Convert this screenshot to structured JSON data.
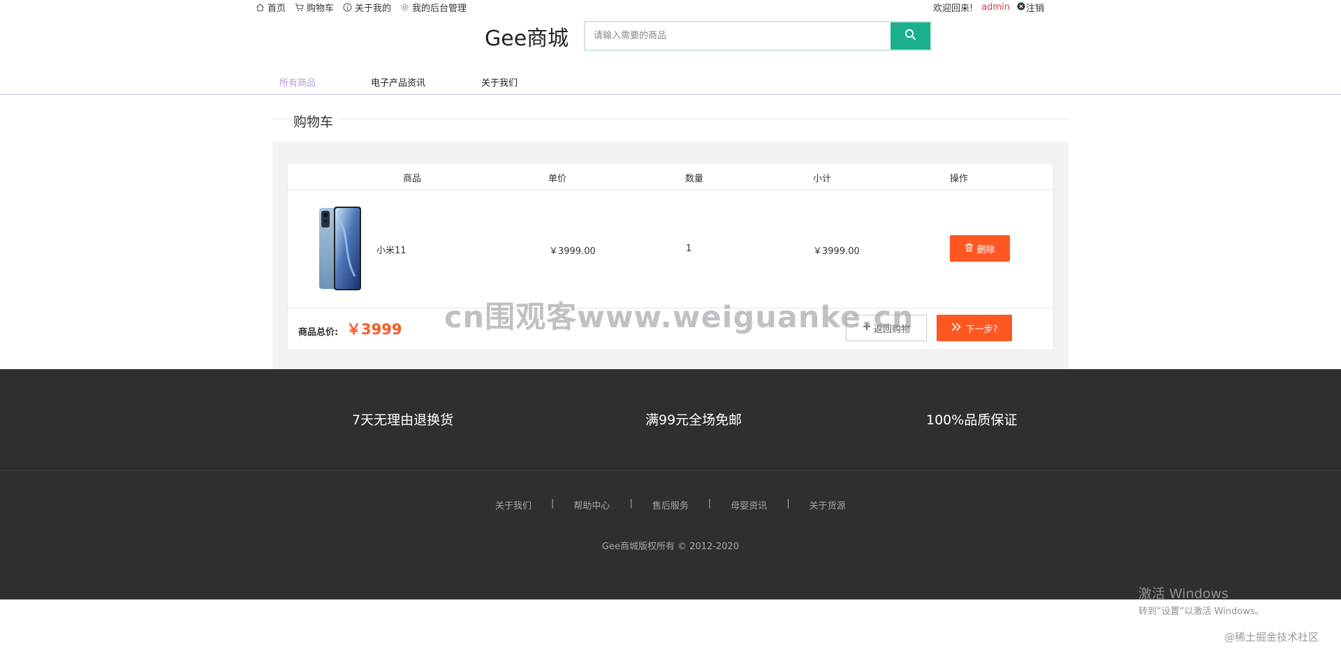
{
  "topnav": {
    "items": [
      {
        "label": "首页",
        "icon": "home-icon"
      },
      {
        "label": "购物车",
        "icon": "cart-icon"
      },
      {
        "label": "关于我的",
        "icon": "info-icon"
      },
      {
        "label": "我的后台管理",
        "icon": "gear-icon"
      }
    ],
    "welcome": "欢迎回来!",
    "username": "admin",
    "logout": "注销"
  },
  "header": {
    "brand": "Gee商城",
    "search_placeholder": "请输入需要的商品"
  },
  "catnav": {
    "items": [
      "所有商品",
      "电子产品资讯",
      "关于我们"
    ],
    "active": "所有商品"
  },
  "section": {
    "title": "购物车"
  },
  "cart": {
    "columns": [
      "商品",
      "单价",
      "数量",
      "小计",
      "操作"
    ],
    "items": [
      {
        "name": "小米11",
        "price": "￥3999.00",
        "qty": "1",
        "subtotal": "￥3999.00",
        "delete_label": "删除"
      }
    ],
    "total_label": "商品总价:",
    "total_value": "￥3999",
    "back_label": "返回购物",
    "next_label": "下一步?"
  },
  "watermark": "cn围观客www.weiguanke.cn",
  "footer": {
    "promises": [
      "7天无理由退换货",
      "满99元全场免邮",
      "100%品质保证"
    ],
    "links": [
      "关于我们",
      "帮助中心",
      "售后服务",
      "母婴资讯",
      "关于货源"
    ],
    "separator": "|",
    "copyright": "Gee商城版权所有 © 2012-2020"
  },
  "overlay": {
    "activate_title": "激活 Windows",
    "activate_sub": "转到“设置”以激活 Windows。",
    "community": "@稀土掘金技术社区"
  },
  "colors": {
    "accent_orange": "#ff5722",
    "search_green": "#1bb08c",
    "active_nav": "#b79ad6",
    "username_red": "#e4393c",
    "footer_bg": "#2f2f2f"
  }
}
